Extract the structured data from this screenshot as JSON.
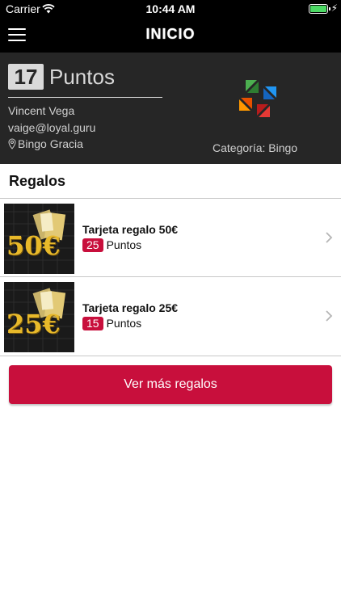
{
  "status_bar": {
    "carrier": "Carrier",
    "time": "10:44 AM"
  },
  "nav": {
    "title": "INICIO",
    "menu_icon": "hamburger-menu-icon"
  },
  "profile": {
    "points_value": "17",
    "points_label": "Puntos",
    "name": "Vincent Vega",
    "email": "vaige@loyal.guru",
    "location_icon": "map-pin-icon",
    "location": "Bingo Gracia",
    "category": "Categoría: Bingo"
  },
  "gifts_section": {
    "title": "Regalos",
    "items": [
      {
        "name": "Tarjeta regalo 50€",
        "points": "25",
        "points_label": "Puntos",
        "thumb_text": "50€"
      },
      {
        "name": "Tarjeta regalo 25€",
        "points": "15",
        "points_label": "Puntos",
        "thumb_text": "25€"
      }
    ],
    "more_button": "Ver más regalos"
  },
  "colors": {
    "accent": "#c80f3c",
    "header_bg": "#262626",
    "nav_bg": "#000000"
  }
}
